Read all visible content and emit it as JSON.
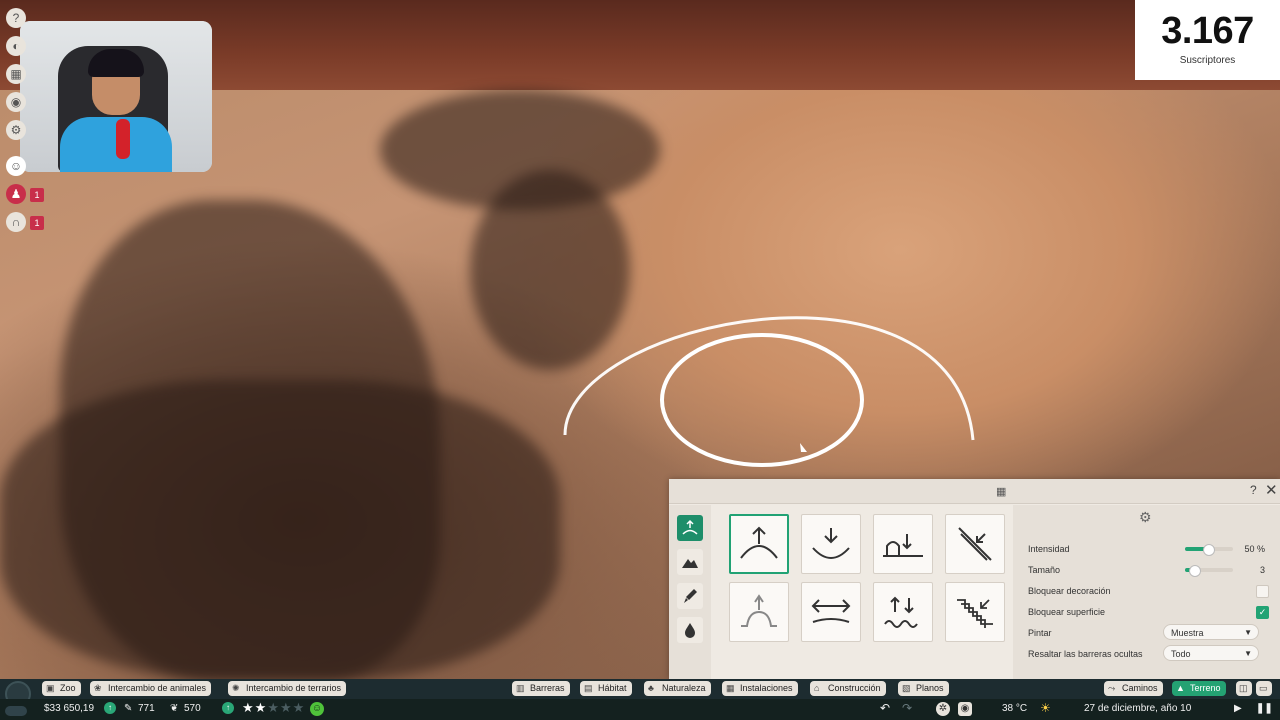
{
  "subscriber_counter": {
    "count": "3.167",
    "label": "Suscriptores"
  },
  "left_sidebar": {
    "badges": [
      "1",
      "1"
    ]
  },
  "terrain_panel": {
    "help": "?",
    "close": "✕",
    "settings": {
      "rows": [
        {
          "label": "Intensidad",
          "value": "50 %",
          "slider_fraction": 0.5
        },
        {
          "label": "Tamaño",
          "value": "3",
          "slider_fraction": 0.2
        },
        {
          "label": "Bloquear decoración",
          "checked": false
        },
        {
          "label": "Bloquear superficie",
          "checked": true
        },
        {
          "label": "Pintar",
          "select": "Muestra"
        },
        {
          "label": "Resaltar las barreras ocultas",
          "select": "Todo"
        }
      ]
    }
  },
  "bottom_nav": {
    "left": [
      "Zoo",
      "Intercambio de animales",
      "Intercambio de terrarios"
    ],
    "center": [
      "Barreras",
      "Hábitat",
      "Naturaleza",
      "Instalaciones",
      "Construcción",
      "Planos"
    ],
    "right": [
      "Caminos",
      "Terreno"
    ]
  },
  "status_bar": {
    "money": "$33 650,19",
    "guests": "771",
    "animals": "570",
    "rating_stars": 2,
    "rating_max": 5,
    "temperature": "38 °C",
    "date": "27 de diciembre, año 10"
  },
  "colors": {
    "accent": "#24a273",
    "badge": "#c82e4a",
    "bar": "#1d2c30"
  }
}
